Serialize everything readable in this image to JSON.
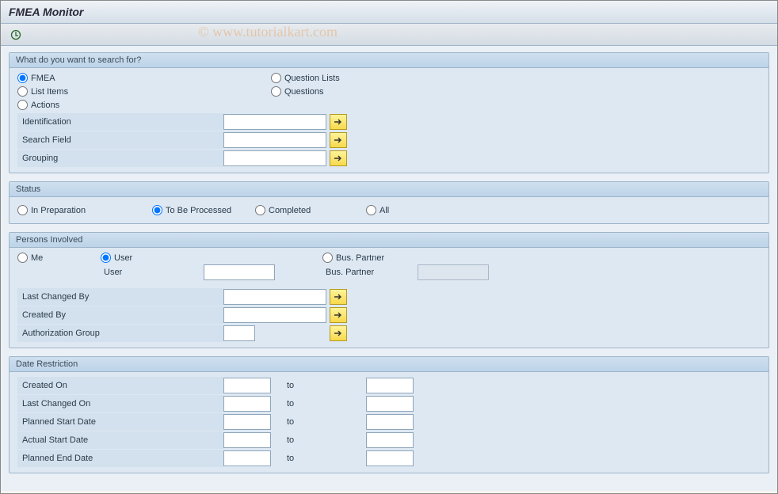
{
  "title": "FMEA Monitor",
  "watermark": "© www.tutorialkart.com",
  "search_panel": {
    "header": "What do you want to search for?",
    "options": {
      "fmea": "FMEA",
      "question_lists": "Question Lists",
      "list_items": "List Items",
      "questions": "Questions",
      "actions": "Actions"
    },
    "selected": "fmea",
    "fields": {
      "identification": "Identification",
      "search_field": "Search Field",
      "grouping": "Grouping"
    }
  },
  "status_panel": {
    "header": "Status",
    "options": {
      "in_prep": "In Preparation",
      "to_process": "To Be Processed",
      "completed": "Completed",
      "all": "All"
    },
    "selected": "to_process"
  },
  "persons_panel": {
    "header": "Persons Involved",
    "options": {
      "me": "Me",
      "user": "User",
      "bus_partner": "Bus. Partner"
    },
    "selected": "user",
    "labels": {
      "user": "User",
      "bus_partner": "Bus. Partner",
      "last_changed_by": "Last Changed By",
      "created_by": "Created By",
      "auth_group": "Authorization Group"
    }
  },
  "date_panel": {
    "header": "Date Restriction",
    "to": "to",
    "rows": [
      "Created On",
      "Last Changed On",
      "Planned Start Date",
      "Actual Start Date",
      "Planned End Date"
    ]
  }
}
